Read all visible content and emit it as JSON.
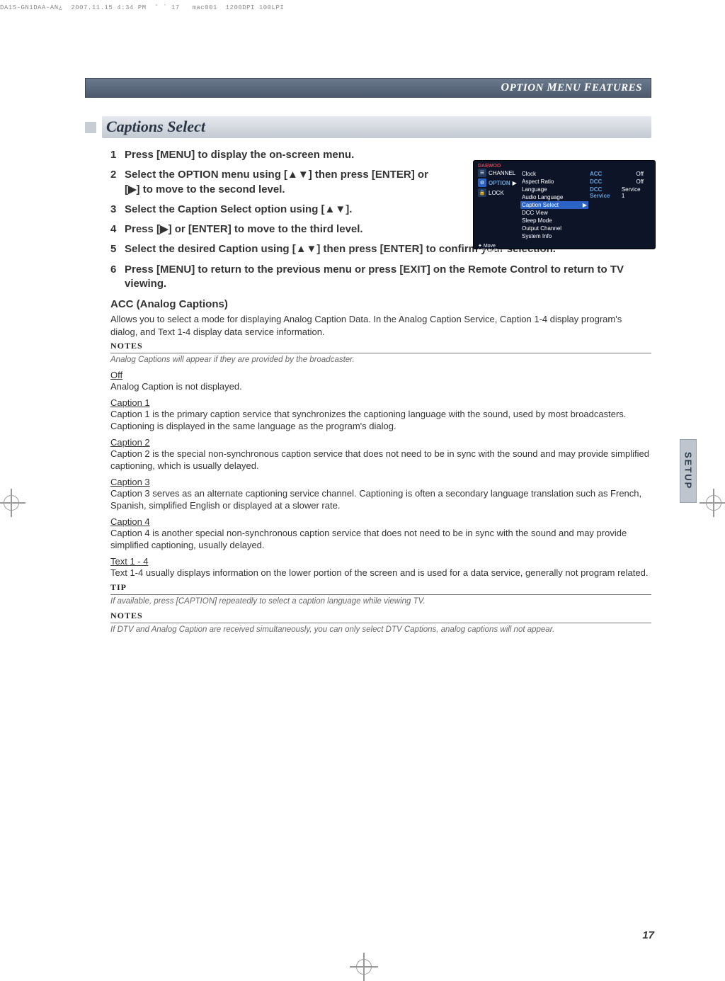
{
  "filmstrip": "DA1S-GN1DAA-AN¿  2007.11.15 4:34 PM  ˘ ` 17   mac001  1200DPI 100LPI",
  "header": {
    "large1": "O",
    "small1": "PTION",
    "large2": "M",
    "small2": "ENU",
    "large3": "F",
    "small3": "EATURES"
  },
  "section_title": "Captions Select",
  "steps": [
    "Press [MENU] to display the on-screen menu.",
    "Select the OPTION menu using [▲▼] then press [ENTER] or [▶] to move to the second level.",
    "Select the Caption Select option using [▲▼].",
    "Press [▶] or [ENTER] to move to the third level.",
    "Select the desired Caption using [▲▼] then press [ENTER] to confirm your selection.",
    "Press [MENU] to return to the previous menu or press [EXIT] on the Remote Control to return to TV viewing."
  ],
  "acc_head": "ACC (Analog Captions)",
  "acc_body": "Allows you to select a mode for displaying Analog Caption Data. In the Analog Caption Service, Caption 1-4 display program's dialog, and Text 1-4 display data service information.",
  "notes_label": "NOTES",
  "tip_label": "TIP",
  "note1": "Analog Captions will appear if they are provided by the broadcaster.",
  "items": {
    "off_h": "Off",
    "off_b": "Analog Caption is not displayed.",
    "c1_h": "Caption 1",
    "c1_b": "Caption 1 is the primary caption service that synchronizes the captioning language with the sound, used by most broadcasters. Captioning is displayed in the same language as the program's dialog.",
    "c2_h": "Caption 2",
    "c2_b": "Caption 2 is the special non-synchronous caption service that does not need to be in sync with the sound and may provide simplified captioning, which is usually delayed.",
    "c3_h": "Caption 3",
    "c3_b": "Caption 3 serves as an alternate captioning service channel. Captioning is often a secondary language translation such as French, Spanish, simplified English or displayed at a slower rate.",
    "c4_h": "Caption 4",
    "c4_b": "Caption 4 is another special non-synchronous caption service that does not need to be in sync with the sound and may provide simplified captioning, usually delayed.",
    "t_h": "Text 1 - 4",
    "t_b": "Text 1-4 usually displays information on the lower portion of the screen and is used for a data service, generally not program related."
  },
  "tip_text": "If available, press [CAPTION] repeatedly to select a caption language while viewing TV.",
  "note2": "If DTV and Analog Caption are received simultaneously, you can only select DTV Captions, analog captions will not appear.",
  "sidebar": "SETUP",
  "page_num": "17",
  "osd": {
    "logo": "DAEWOO",
    "left": [
      "CHANNEL",
      "OPTION",
      "LOCK"
    ],
    "mid": [
      "Clock",
      "Aspect Ratio",
      "Language",
      "Audio Language",
      "Caption Select",
      "DCC View",
      "Sleep Mode",
      "Output Channel",
      "System Info"
    ],
    "right": [
      {
        "k": "ACC",
        "v": "Off"
      },
      {
        "k": "DCC",
        "v": "Off"
      },
      {
        "k": "DCC Service",
        "v": "Service 1"
      }
    ],
    "move": "Move",
    "prev": "Prev."
  }
}
